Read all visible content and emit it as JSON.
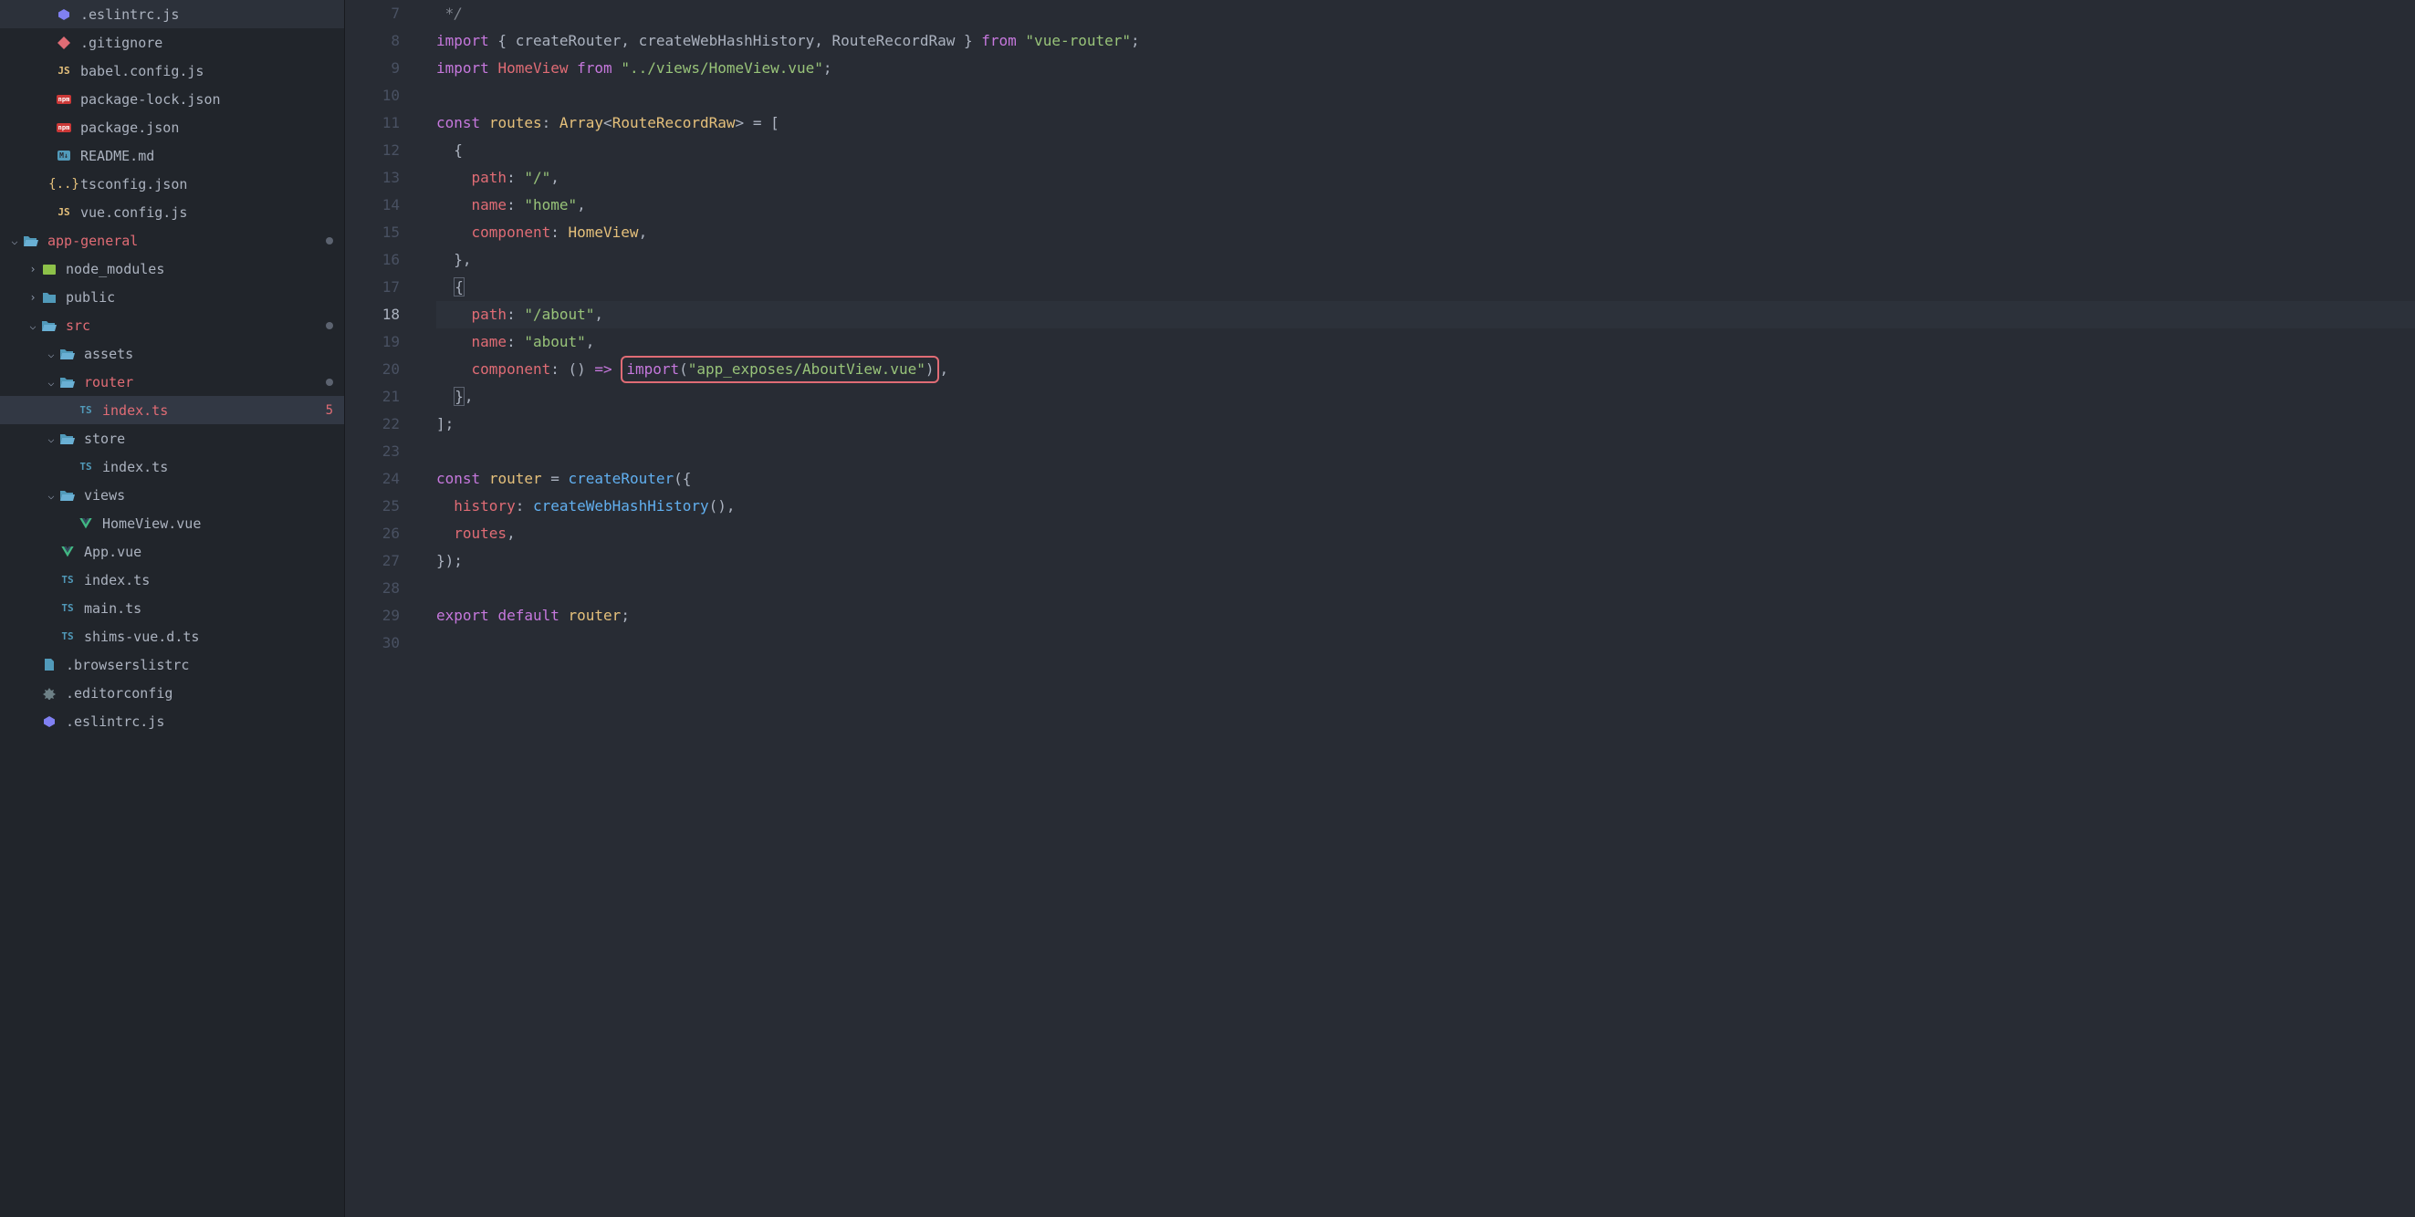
{
  "sidebar": {
    "items": [
      {
        "indent": 36,
        "icon": "eslint",
        "label": ".eslintrc.js",
        "chevron": "",
        "modified": false
      },
      {
        "indent": 36,
        "icon": "git",
        "label": ".gitignore",
        "chevron": "",
        "modified": false
      },
      {
        "indent": 36,
        "icon": "js",
        "label": "babel.config.js",
        "chevron": "",
        "modified": false
      },
      {
        "indent": 36,
        "icon": "npm",
        "label": "package-lock.json",
        "chevron": "",
        "modified": false
      },
      {
        "indent": 36,
        "icon": "npm",
        "label": "package.json",
        "chevron": "",
        "modified": false
      },
      {
        "indent": 36,
        "icon": "md",
        "label": "README.md",
        "chevron": "",
        "modified": false
      },
      {
        "indent": 36,
        "icon": "json",
        "label": "tsconfig.json",
        "chevron": "",
        "modified": false
      },
      {
        "indent": 36,
        "icon": "js",
        "label": "vue.config.js",
        "chevron": "",
        "modified": false
      },
      {
        "indent": 0,
        "icon": "folder-open",
        "label": "app-general",
        "chevron": "down",
        "modified": true,
        "dot": true
      },
      {
        "indent": 20,
        "icon": "folder-special",
        "label": "node_modules",
        "chevron": "right",
        "modified": false
      },
      {
        "indent": 20,
        "icon": "folder",
        "label": "public",
        "chevron": "right",
        "modified": false
      },
      {
        "indent": 20,
        "icon": "folder-open",
        "label": "src",
        "chevron": "down",
        "modified": true,
        "dot": true
      },
      {
        "indent": 40,
        "icon": "folder-open",
        "label": "assets",
        "chevron": "down",
        "modified": false
      },
      {
        "indent": 40,
        "icon": "folder-open",
        "label": "router",
        "chevron": "down",
        "modified": true,
        "dot": true
      },
      {
        "indent": 60,
        "icon": "ts",
        "label": "index.ts",
        "chevron": "",
        "modified": true,
        "error": "5",
        "selected": true
      },
      {
        "indent": 40,
        "icon": "folder-open",
        "label": "store",
        "chevron": "down",
        "modified": false
      },
      {
        "indent": 60,
        "icon": "ts",
        "label": "index.ts",
        "chevron": "",
        "modified": false
      },
      {
        "indent": 40,
        "icon": "folder-open",
        "label": "views",
        "chevron": "down",
        "modified": false
      },
      {
        "indent": 60,
        "icon": "vue",
        "label": "HomeView.vue",
        "chevron": "",
        "modified": false
      },
      {
        "indent": 40,
        "icon": "vue",
        "label": "App.vue",
        "chevron": "",
        "modified": false
      },
      {
        "indent": 40,
        "icon": "ts",
        "label": "index.ts",
        "chevron": "",
        "modified": false
      },
      {
        "indent": 40,
        "icon": "ts",
        "label": "main.ts",
        "chevron": "",
        "modified": false
      },
      {
        "indent": 40,
        "icon": "ts",
        "label": "shims-vue.d.ts",
        "chevron": "",
        "modified": false
      },
      {
        "indent": 20,
        "icon": "generic",
        "label": ".browserslistrc",
        "chevron": "",
        "modified": false
      },
      {
        "indent": 20,
        "icon": "config",
        "label": ".editorconfig",
        "chevron": "",
        "modified": false
      },
      {
        "indent": 20,
        "icon": "eslint",
        "label": ".eslintrc.js",
        "chevron": "",
        "modified": false
      }
    ]
  },
  "editor": {
    "startLine": 7,
    "currentLine": 18,
    "lines": [
      {
        "n": 7,
        "tokens": [
          {
            "t": " */",
            "c": "comment"
          }
        ]
      },
      {
        "n": 8,
        "tokens": [
          {
            "t": "import",
            "c": "keyword"
          },
          {
            "t": " { ",
            "c": "punct"
          },
          {
            "t": "createRouter",
            "c": "plain"
          },
          {
            "t": ", ",
            "c": "punct"
          },
          {
            "t": "createWebHashHistory",
            "c": "plain"
          },
          {
            "t": ", ",
            "c": "punct"
          },
          {
            "t": "RouteRecordRaw",
            "c": "plain"
          },
          {
            "t": " } ",
            "c": "punct"
          },
          {
            "t": "from",
            "c": "keyword"
          },
          {
            "t": " ",
            "c": "punct"
          },
          {
            "t": "\"vue-router\"",
            "c": "string"
          },
          {
            "t": ";",
            "c": "punct"
          }
        ]
      },
      {
        "n": 9,
        "tokens": [
          {
            "t": "import",
            "c": "keyword"
          },
          {
            "t": " ",
            "c": "punct"
          },
          {
            "t": "HomeView",
            "c": "prop"
          },
          {
            "t": " ",
            "c": "punct"
          },
          {
            "t": "from",
            "c": "keyword"
          },
          {
            "t": " ",
            "c": "punct"
          },
          {
            "t": "\"../views/HomeView.vue\"",
            "c": "string"
          },
          {
            "t": ";",
            "c": "punct"
          }
        ]
      },
      {
        "n": 10,
        "tokens": []
      },
      {
        "n": 11,
        "tokens": [
          {
            "t": "const",
            "c": "keyword"
          },
          {
            "t": " ",
            "c": "punct"
          },
          {
            "t": "routes",
            "c": "var"
          },
          {
            "t": ": ",
            "c": "punct"
          },
          {
            "t": "Array",
            "c": "type"
          },
          {
            "t": "<",
            "c": "punct"
          },
          {
            "t": "RouteRecordRaw",
            "c": "type"
          },
          {
            "t": "> = [",
            "c": "punct"
          }
        ]
      },
      {
        "n": 12,
        "tokens": [
          {
            "t": "  {",
            "c": "punct"
          }
        ]
      },
      {
        "n": 13,
        "tokens": [
          {
            "t": "    ",
            "c": "punct"
          },
          {
            "t": "path",
            "c": "prop"
          },
          {
            "t": ": ",
            "c": "punct"
          },
          {
            "t": "\"/\"",
            "c": "string"
          },
          {
            "t": ",",
            "c": "punct"
          }
        ]
      },
      {
        "n": 14,
        "tokens": [
          {
            "t": "    ",
            "c": "punct"
          },
          {
            "t": "name",
            "c": "prop"
          },
          {
            "t": ": ",
            "c": "punct"
          },
          {
            "t": "\"home\"",
            "c": "string"
          },
          {
            "t": ",",
            "c": "punct"
          }
        ]
      },
      {
        "n": 15,
        "tokens": [
          {
            "t": "    ",
            "c": "punct"
          },
          {
            "t": "component",
            "c": "prop"
          },
          {
            "t": ": ",
            "c": "punct"
          },
          {
            "t": "HomeView",
            "c": "var"
          },
          {
            "t": ",",
            "c": "punct"
          }
        ]
      },
      {
        "n": 16,
        "tokens": [
          {
            "t": "  },",
            "c": "punct"
          }
        ]
      },
      {
        "n": 17,
        "tokens": [
          {
            "t": "  ",
            "c": "punct"
          },
          {
            "t": "{",
            "c": "punct",
            "bracket": true
          }
        ]
      },
      {
        "n": 18,
        "tokens": [
          {
            "t": "    ",
            "c": "punct"
          },
          {
            "t": "path",
            "c": "prop"
          },
          {
            "t": ": ",
            "c": "punct"
          },
          {
            "t": "\"/about\"",
            "c": "string"
          },
          {
            "t": ",",
            "c": "punct"
          }
        ],
        "current": true
      },
      {
        "n": 19,
        "tokens": [
          {
            "t": "    ",
            "c": "punct"
          },
          {
            "t": "name",
            "c": "prop"
          },
          {
            "t": ": ",
            "c": "punct"
          },
          {
            "t": "\"about\"",
            "c": "string"
          },
          {
            "t": ",",
            "c": "punct"
          }
        ]
      },
      {
        "n": 20,
        "tokens": [
          {
            "t": "    ",
            "c": "punct"
          },
          {
            "t": "component",
            "c": "prop"
          },
          {
            "t": ": () ",
            "c": "punct"
          },
          {
            "t": "=>",
            "c": "keyword"
          },
          {
            "t": " ",
            "c": "punct"
          }
        ],
        "highlight": [
          {
            "t": "import",
            "c": "keyword"
          },
          {
            "t": "(",
            "c": "punct"
          },
          {
            "t": "\"app_exposes/AboutView.vue\"",
            "c": "string"
          },
          {
            "t": ")",
            "c": "punct"
          }
        ],
        "after": [
          {
            "t": ",",
            "c": "punct"
          }
        ]
      },
      {
        "n": 21,
        "tokens": [
          {
            "t": "  ",
            "c": "punct"
          },
          {
            "t": "}",
            "c": "punct",
            "bracket": true
          },
          {
            "t": ",",
            "c": "punct"
          }
        ]
      },
      {
        "n": 22,
        "tokens": [
          {
            "t": "];",
            "c": "punct"
          }
        ]
      },
      {
        "n": 23,
        "tokens": []
      },
      {
        "n": 24,
        "tokens": [
          {
            "t": "const",
            "c": "keyword"
          },
          {
            "t": " ",
            "c": "punct"
          },
          {
            "t": "router",
            "c": "var"
          },
          {
            "t": " = ",
            "c": "punct"
          },
          {
            "t": "createRouter",
            "c": "func"
          },
          {
            "t": "({",
            "c": "punct"
          }
        ]
      },
      {
        "n": 25,
        "tokens": [
          {
            "t": "  ",
            "c": "punct"
          },
          {
            "t": "history",
            "c": "prop"
          },
          {
            "t": ": ",
            "c": "punct"
          },
          {
            "t": "createWebHashHistory",
            "c": "func"
          },
          {
            "t": "(),",
            "c": "punct"
          }
        ]
      },
      {
        "n": 26,
        "tokens": [
          {
            "t": "  ",
            "c": "punct"
          },
          {
            "t": "routes",
            "c": "prop"
          },
          {
            "t": ",",
            "c": "punct"
          }
        ]
      },
      {
        "n": 27,
        "tokens": [
          {
            "t": "});",
            "c": "punct"
          }
        ]
      },
      {
        "n": 28,
        "tokens": []
      },
      {
        "n": 29,
        "tokens": [
          {
            "t": "export",
            "c": "keyword"
          },
          {
            "t": " ",
            "c": "punct"
          },
          {
            "t": "default",
            "c": "keyword"
          },
          {
            "t": " ",
            "c": "punct"
          },
          {
            "t": "router",
            "c": "var"
          },
          {
            "t": ";",
            "c": "punct"
          }
        ]
      },
      {
        "n": 30,
        "tokens": []
      }
    ]
  }
}
